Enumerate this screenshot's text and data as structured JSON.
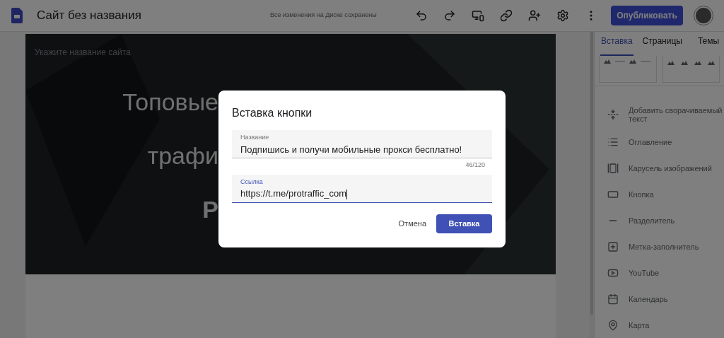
{
  "app": {
    "title": "Сайт без названия",
    "save_status": "Все изменения на Диске сохранены",
    "publish_button": "Опубликовать"
  },
  "editor": {
    "site_name_placeholder": "Укажите название сайта",
    "hero_lines": [
      "Топовые",
      "трафи",
      "Р"
    ]
  },
  "panel": {
    "tabs": [
      {
        "label": "Вставка",
        "selected": true
      },
      {
        "label": "Страницы",
        "selected": false
      },
      {
        "label": "Темы",
        "selected": false
      }
    ],
    "items": [
      {
        "label": "Добавить сворачиваемый текст"
      },
      {
        "label": "Оглавление"
      },
      {
        "label": "Карусель изображений"
      },
      {
        "label": "Кнопка"
      },
      {
        "label": "Разделитель"
      },
      {
        "label": "Метка-заполнитель"
      },
      {
        "label": "YouTube"
      },
      {
        "label": "Календарь"
      },
      {
        "label": "Карта"
      }
    ]
  },
  "dialog": {
    "title": "Вставка кнопки",
    "fields": [
      {
        "label": "Название",
        "value": "Подпишись и получи мобильные прокси бесплатно!",
        "counter": "46/120",
        "focused": false
      },
      {
        "label": "Ссылка",
        "value": "https://t.me/protraffic_com",
        "focused": true
      }
    ],
    "buttons": [
      {
        "label": "Отмена",
        "kind": "text"
      },
      {
        "label": "Вставка",
        "kind": "primary"
      }
    ]
  }
}
